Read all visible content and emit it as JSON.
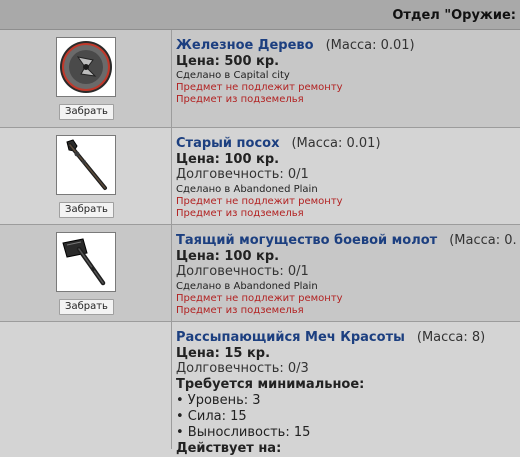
{
  "header": {
    "title": "Отдел \"Оружие:"
  },
  "items": [
    {
      "name": "Железное Дерево",
      "mass": "(Масса: 0.01)",
      "price": "Цена: 500 кр.",
      "made": "Сделано в Capital city",
      "warn1": "Предмет не подлежит ремонту",
      "warn2": "Предмет из подземелья",
      "button": "Забрать",
      "icon": "medallion-icon"
    },
    {
      "name": "Старый посох",
      "mass": "(Масса: 0.01)",
      "price": "Цена: 100 кр.",
      "durability": "Долговечность: 0/1",
      "made": "Сделано в Abandoned Plain",
      "warn1": "Предмет не подлежит ремонту",
      "warn2": "Предмет из подземелья",
      "button": "Забрать",
      "icon": "staff-icon"
    },
    {
      "name": "Таящий могущество боевой молот",
      "mass": "(Масса: 0.",
      "price": "Цена: 100 кр.",
      "durability": "Долговечность: 0/1",
      "made": "Сделано в Abandoned Plain",
      "warn1": "Предмет не подлежит ремонту",
      "warn2": "Предмет из подземелья",
      "button": "Забрать",
      "icon": "hammer-icon"
    },
    {
      "name": "Рассыпающийся Меч Красоты",
      "mass": "(Масса: 8)",
      "price": "Цена: 15 кр.",
      "durability": "Долговечность: 0/3",
      "req_title": "Требуется минимальное:",
      "req1": "• Уровень: 3",
      "req2": "• Сила: 15",
      "req3": "• Выносливость: 15",
      "act_title": "Действует на:"
    }
  ]
}
